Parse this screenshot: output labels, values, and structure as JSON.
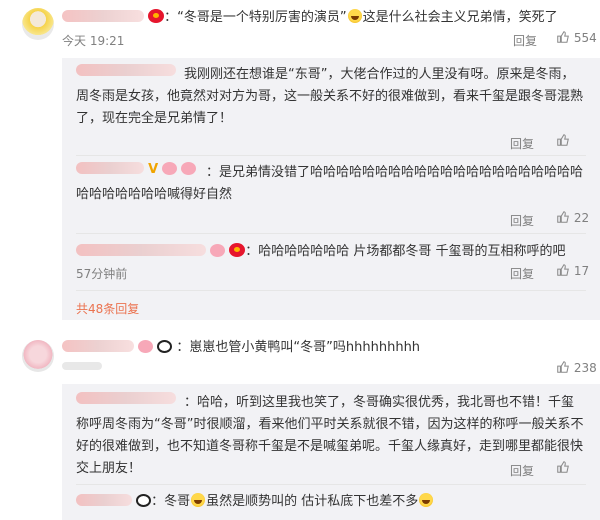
{
  "comments": [
    {
      "text_a": "：“冬哥是一个特别厉害的演员”",
      "text_b": "这是什么社会主义兄弟情，笑死了",
      "time": "今天 19:21",
      "reply_label": "回复",
      "like_count": "554",
      "replies": [
        {
          "text": "我刚刚还在想谁是“东哥”，大佬合作过的人里没有呀。原来是冬雨，周冬雨是女孩，他竟然对对方为哥，这一般关系不好的很难做到，看来千玺是跟冬哥混熟了，现在完全是兄弟情了！",
          "reply_label": "回复",
          "like_count": ""
        },
        {
          "text": "：是兄弟情没错了哈哈哈哈哈哈哈哈哈哈哈哈哈哈哈哈哈哈哈哈哈哈哈哈哈哈哈哈喊得好自然",
          "reply_label": "回复",
          "like_count": "22"
        },
        {
          "text": "：哈哈哈哈哈哈哈  片场都都冬哥 千玺哥的互相称呼的吧",
          "time": "57分钟前",
          "reply_label": "回复",
          "like_count": "17"
        }
      ],
      "more_link": "共48条回复"
    },
    {
      "text": "：崽崽也管小黄鸭叫“冬哥”吗hhhhhhhhh",
      "like_count": "238",
      "replies": [
        {
          "text": "：哈哈，听到这里我也笑了，冬哥确实很优秀，我北哥也不错！千玺称呼周冬雨为“冬哥”时很顺溜，看来他们平时关系就很不错，因为这样的称呼一般关系不好的很难做到，也不知道冬哥称千玺是不是喊玺弟呢。千玺人缘真好，走到哪里都能很快交上朋友！",
          "reply_label": "回复"
        },
        {
          "text_a": "：冬哥",
          "text_b": "虽然是顺势叫的 估计私底下也差不多"
        }
      ]
    }
  ],
  "icons": [
    "weibo-logo-icon",
    "laugh-emoji-icon",
    "thumb-up-icon",
    "v-badge-icon",
    "panda-emoji-icon",
    "pig-emoji-icon"
  ],
  "colors": {
    "link": "#eb7350",
    "muted": "#808080",
    "reply_bg": "#f2f2f5"
  }
}
